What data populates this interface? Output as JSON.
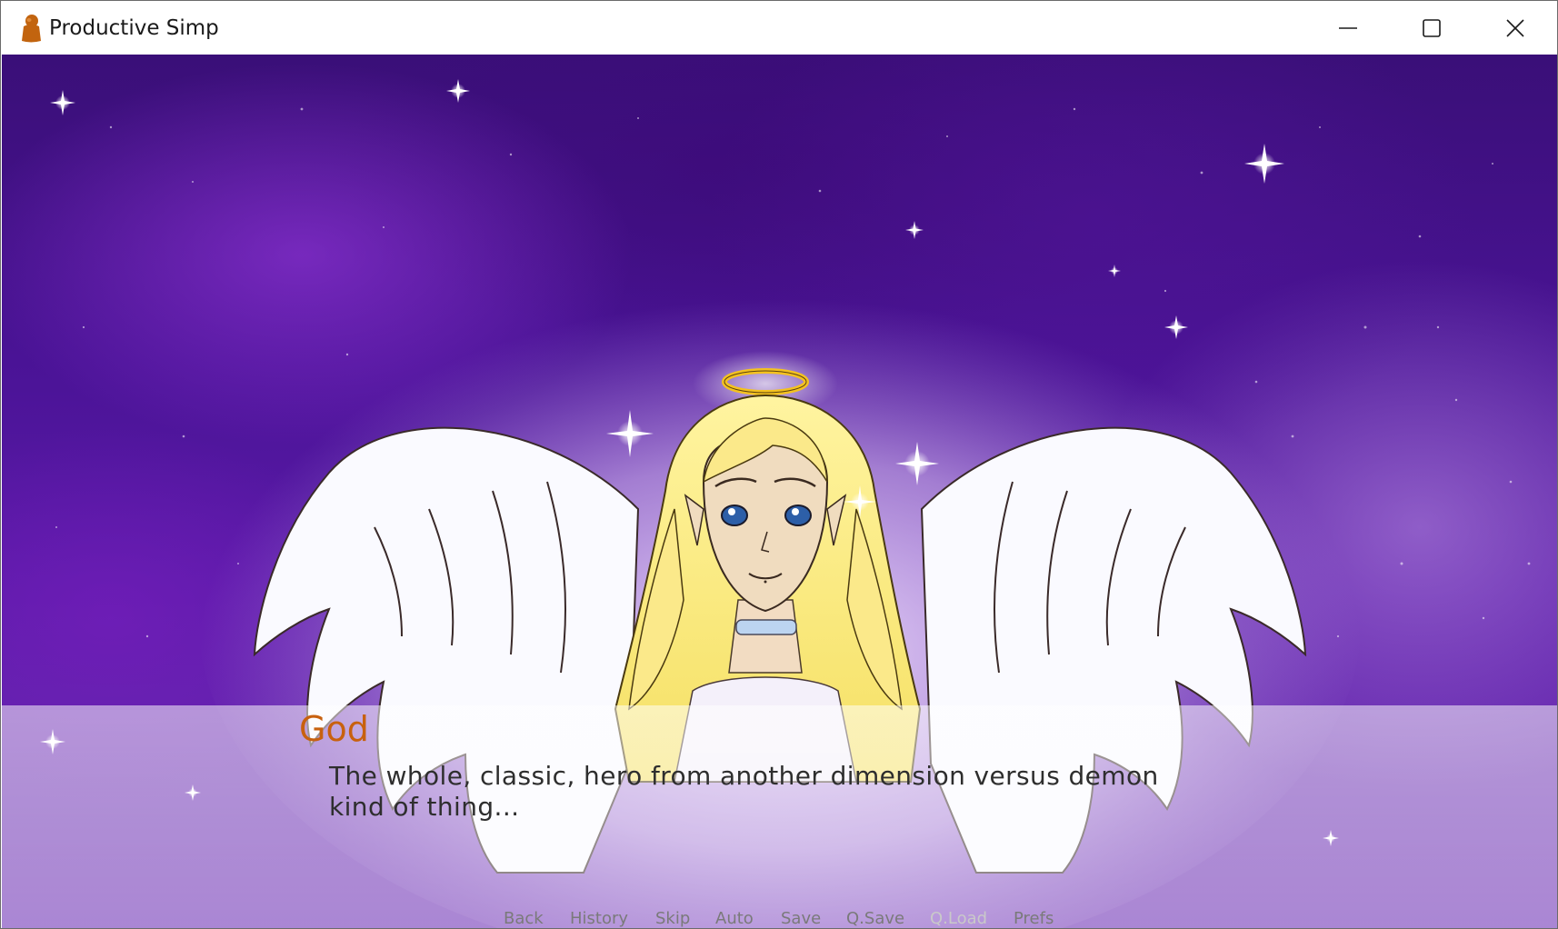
{
  "window": {
    "title": "Productive Simp",
    "icon": "orange-figure-app-icon",
    "controls": [
      "minimize-icon",
      "maximize-icon",
      "close-icon"
    ]
  },
  "dialogue": {
    "speaker": "God",
    "speaker_color": "#c8610f",
    "text": "The whole, classic, hero from another dimension versus demon kind of thing..."
  },
  "quick_menu": {
    "items": [
      {
        "label": "Back",
        "enabled": true
      },
      {
        "label": "History",
        "enabled": true
      },
      {
        "label": "Skip",
        "enabled": true
      },
      {
        "label": "Auto",
        "enabled": true
      },
      {
        "label": "Save",
        "enabled": true
      },
      {
        "label": "Q.Save",
        "enabled": true
      },
      {
        "label": "Q.Load",
        "enabled": false
      },
      {
        "label": "Prefs",
        "enabled": true
      }
    ]
  },
  "scene": {
    "background": "purple-starry-nebula",
    "character": "blonde-angel-with-halo-and-wings"
  }
}
